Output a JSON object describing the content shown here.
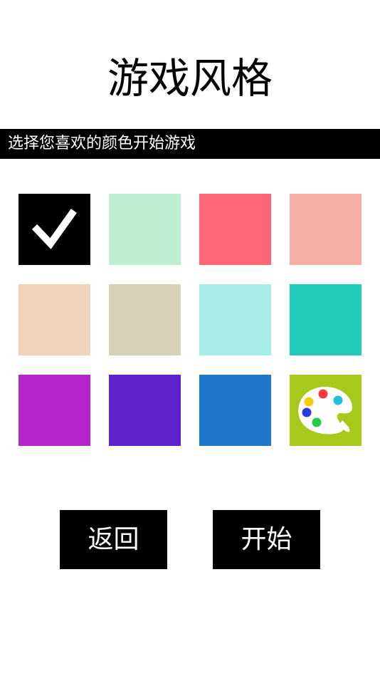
{
  "header": {
    "title": "游戏风格",
    "subtitle": "选择您喜欢的颜色开始游戏"
  },
  "swatches": [
    {
      "id": "black",
      "color": "#000000",
      "selected": true,
      "icon": "check-icon"
    },
    {
      "id": "mint",
      "color": "#bdeed2",
      "selected": false
    },
    {
      "id": "coral-red",
      "color": "#fe6677",
      "selected": false
    },
    {
      "id": "salmon",
      "color": "#f6afa6",
      "selected": false
    },
    {
      "id": "peach",
      "color": "#f1d2bb",
      "selected": false
    },
    {
      "id": "khaki",
      "color": "#d6d2b6",
      "selected": false
    },
    {
      "id": "aqua",
      "color": "#a7eee6",
      "selected": false
    },
    {
      "id": "teal",
      "color": "#22cbb9",
      "selected": false
    },
    {
      "id": "magenta",
      "color": "#b723cc",
      "selected": false
    },
    {
      "id": "violet",
      "color": "#5f23cc",
      "selected": false
    },
    {
      "id": "blue",
      "color": "#2277cc",
      "selected": false
    },
    {
      "id": "custom",
      "color": "#a9c81c",
      "selected": false,
      "icon": "paint-palette-icon"
    }
  ],
  "buttons": {
    "back_label": "返回",
    "start_label": "开始"
  }
}
